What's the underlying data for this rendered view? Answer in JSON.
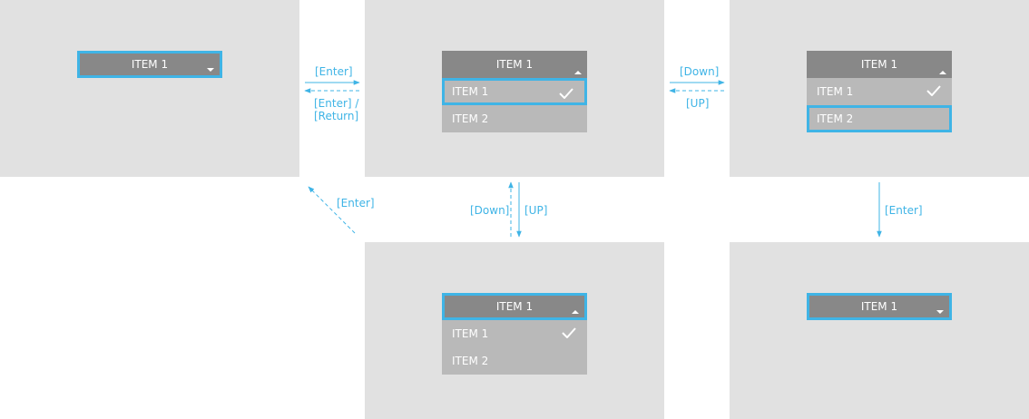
{
  "colors": {
    "panel": "#e1e1e1",
    "header": "#888888",
    "item": "#b9b9b9",
    "focus": "#3fb4e6",
    "text": "#ffffff"
  },
  "states": [
    {
      "id": "closed-initial",
      "header": "ITEM 1",
      "caret": "chevron-down-icon"
    },
    {
      "id": "open-item1-focused",
      "header": "ITEM 1",
      "caret": "chevron-up-icon",
      "items": [
        "ITEM 1",
        "ITEM 2"
      ],
      "checked": "ITEM 1"
    },
    {
      "id": "open-item2-focused",
      "header": "ITEM 1",
      "caret": "chevron-up-icon",
      "items": [
        "ITEM 1",
        "ITEM 2"
      ],
      "checked": "ITEM 1"
    },
    {
      "id": "open-header-focused",
      "header": "ITEM 1",
      "caret": "chevron-up-icon",
      "items": [
        "ITEM 1",
        "ITEM 2"
      ],
      "checked": "ITEM 1"
    },
    {
      "id": "closed-after-select",
      "header": "ITEM 1",
      "caret": "chevron-down-icon"
    }
  ],
  "transitions": {
    "enter_forward": "[Enter]",
    "enter_return_line1": "[Enter] /",
    "enter_return_line2": "[Return]",
    "down_right": "[Down]",
    "up_left": "[UP]",
    "down_vertical": "[Down]",
    "up_vertical": "[UP]",
    "enter_diagonal": "[Enter]",
    "enter_select": "[Enter]"
  }
}
